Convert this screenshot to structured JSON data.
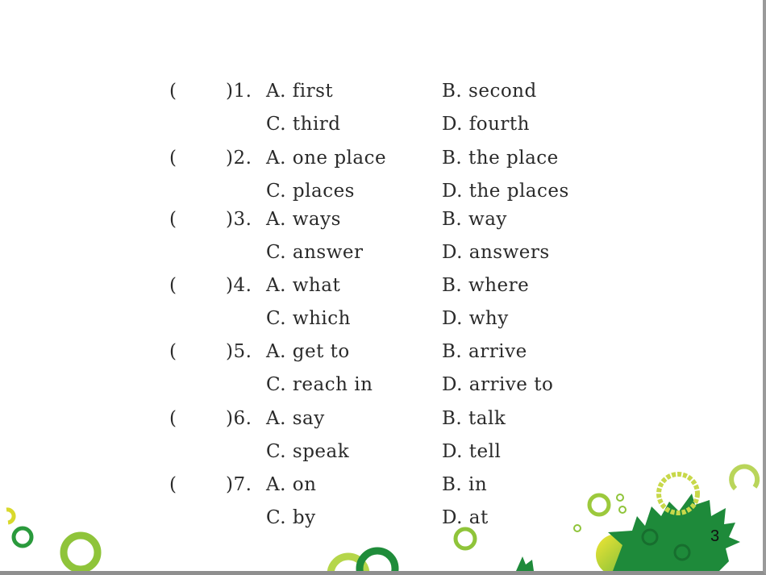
{
  "questions": [
    {
      "number": "1",
      "open": "(",
      "close": ")1.",
      "A": "A.  first",
      "B": "B.  second",
      "C": "C.  third",
      "D": "D.  fourth"
    },
    {
      "number": "2",
      "open": "(",
      "close": ")2.",
      "A": "A.  one place",
      "B": "B.  the place",
      "C": "C.  places",
      "D": "D.  the places"
    },
    {
      "number": "3",
      "open": "(",
      "close": ")3.",
      "A": "A.  ways",
      "B": "B.  way",
      "C": "C.  answer",
      "D": "D.  answers"
    },
    {
      "number": "4",
      "open": "(",
      "close": ")4.",
      "A": "A.  what",
      "B": "B.  where",
      "C": "C.  which",
      "D": "D.  why"
    },
    {
      "number": "5",
      "open": "(",
      "close": ")5.",
      "A": "A.  get to",
      "B": "B.  arrive",
      "C": "C.  reach in",
      "D": "D.  arrive to"
    },
    {
      "number": "6",
      "open": "(",
      "close": ")6.",
      "A": "A.  say",
      "B": "B.  talk",
      "C": "C.  speak",
      "D": "D.  tell"
    },
    {
      "number": "7",
      "open": "(",
      "close": ")7.",
      "A": "A.  on",
      "B": "B.  in",
      "C": "C.  by",
      "D": "D.  at"
    }
  ],
  "page_number": "3",
  "colors": {
    "dark_green": "#1e8a3a",
    "light_green": "#9cc93c",
    "yellow": "#e6df2a",
    "border_gray": "#9a9a9a"
  }
}
